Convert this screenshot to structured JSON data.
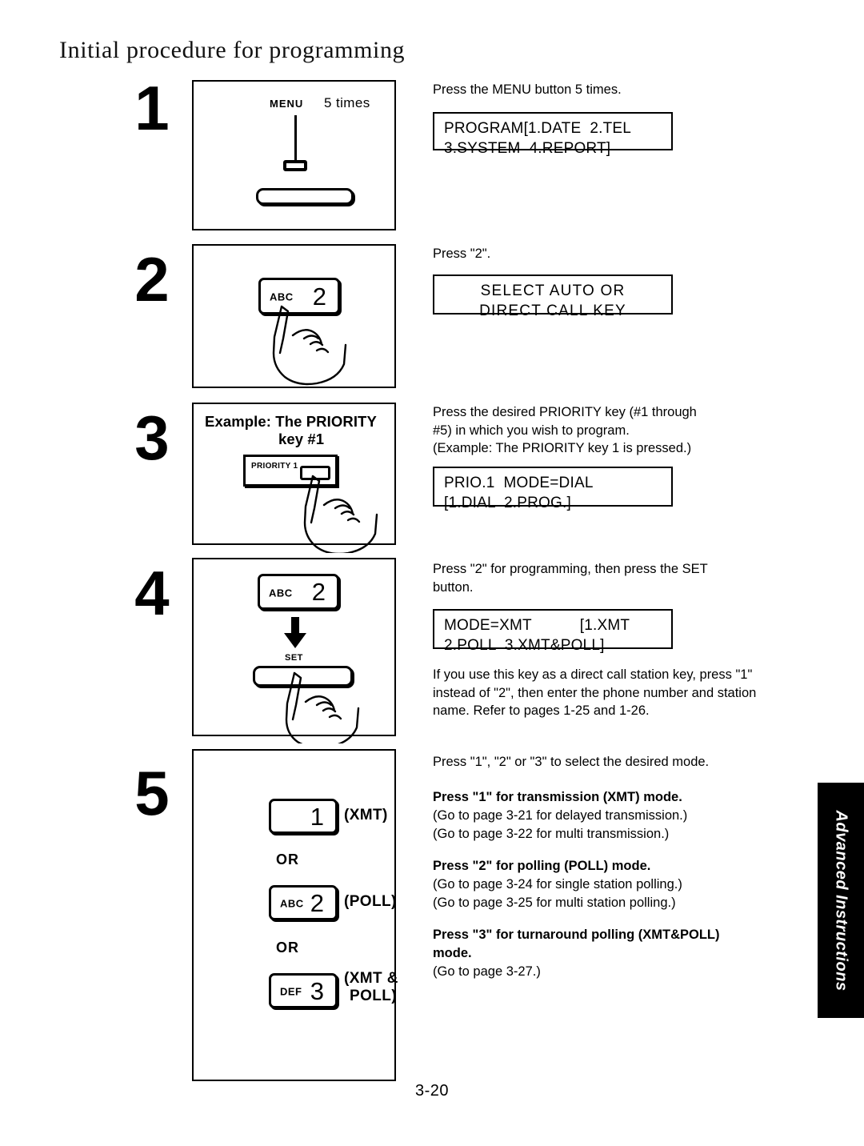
{
  "document": {
    "title": "Initial procedure for programming",
    "page_number": "3-20",
    "side_tab": "Advanced Instructions"
  },
  "steps": [
    {
      "number": "1",
      "panel": {
        "key_label": "MENU",
        "repeat_label": "5 times"
      },
      "instruction": "Press the MENU button 5 times.",
      "lcd": {
        "line1": "PROGRAM[1.DATE  2.TEL",
        "line2": "3.SYSTEM  4.REPORT]",
        "align": "left"
      }
    },
    {
      "number": "2",
      "panel": {
        "key_letters": "ABC",
        "key_digit": "2"
      },
      "instruction": "Press \"2\".",
      "lcd": {
        "line1": "SELECT AUTO OR",
        "line2": "DIRECT CALL KEY",
        "align": "center"
      }
    },
    {
      "number": "3",
      "panel": {
        "example_line1": "Example:  The PRIORITY",
        "example_line2": "key #1",
        "module_label": "PRIORITY 1"
      },
      "instruction_line1": "Press the desired PRIORITY key (#1 through",
      "instruction_line2": "#5) in which you wish to program.",
      "instruction_line3": "(Example:  The PRIORITY key 1 is pressed.)",
      "lcd": {
        "line1": "PRIO.1  MODE=DIAL",
        "line2": "[1.DIAL  2.PROG.]",
        "align": "left"
      }
    },
    {
      "number": "4",
      "panel": {
        "key_letters": "ABC",
        "key_digit": "2",
        "set_label": "SET"
      },
      "instruction_line1": "Press \"2\" for programming, then press the SET",
      "instruction_line2": "button.",
      "lcd": {
        "line1": "MODE=XMT           [1.XMT",
        "line2": "2.POLL  3.XMT&POLL]",
        "align": "left"
      },
      "note": "If you use this key as a direct call station key, press \"1\" instead of \"2\", then enter the phone number and station name. Refer to pages 1-25 and 1-26."
    },
    {
      "number": "5",
      "panel": {
        "options": [
          {
            "letters": "",
            "digit": "1",
            "caption_line1": "(XMT)",
            "caption_line2": ""
          },
          {
            "letters": "ABC",
            "digit": "2",
            "caption_line1": "(POLL)",
            "caption_line2": ""
          },
          {
            "letters": "DEF",
            "digit": "3",
            "caption_line1": "(XMT &",
            "caption_line2": "POLL)"
          }
        ],
        "or_label": "OR"
      },
      "intro": "Press \"1\", \"2\" or \"3\" to select the desired mode.",
      "modes": [
        {
          "heading": "Press \"1\" for transmission (XMT) mode.",
          "detail_line1": "(Go to page 3-21 for delayed transmission.)",
          "detail_line2": "(Go to page 3-22 for multi transmission.)"
        },
        {
          "heading": "Press \"2\" for polling (POLL) mode.",
          "detail_line1": "(Go to page 3-24 for single station polling.)",
          "detail_line2": "(Go to page 3-25 for multi station polling.)"
        },
        {
          "heading_line1": "Press \"3\" for turnaround polling (XMT&POLL)",
          "heading_line2": "mode.",
          "detail_line1": "(Go to page 3-27.)",
          "detail_line2": ""
        }
      ]
    }
  ]
}
